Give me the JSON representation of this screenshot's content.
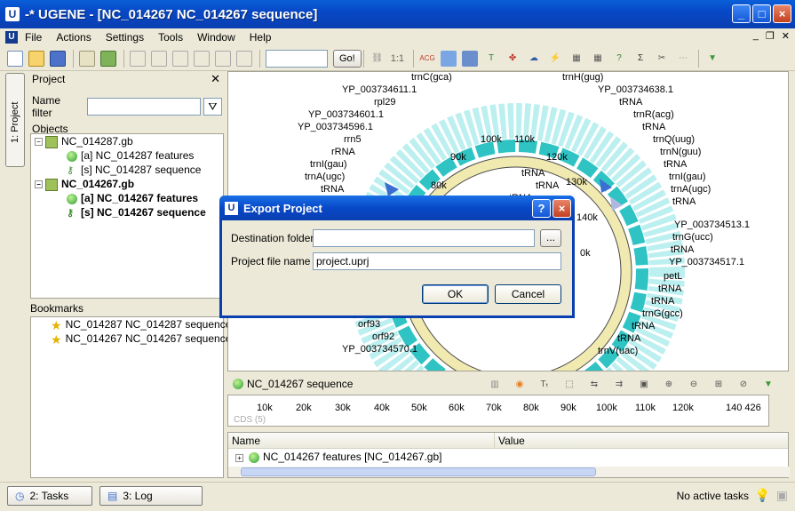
{
  "window": {
    "title": "-* UGENE - [NC_014267 NC_014267 sequence]",
    "app_icon": "U"
  },
  "menu": [
    "File",
    "Actions",
    "Settings",
    "Tools",
    "Window",
    "Help"
  ],
  "toolbar": {
    "go_label": "Go!",
    "zoom_label": "1:1"
  },
  "side_tab": {
    "label": "1: Project"
  },
  "project_panel": {
    "title": "Project",
    "name_filter_label": "Name filter",
    "objects_label": "Objects",
    "tree": [
      {
        "text": "NC_014287.gb",
        "bold": false,
        "level": 0,
        "kind": "gb"
      },
      {
        "text": "[a] NC_014287 features",
        "bold": false,
        "level": 1,
        "kind": "features"
      },
      {
        "text": "[s] NC_014287 sequence",
        "bold": false,
        "level": 1,
        "kind": "sequence"
      },
      {
        "text": "NC_014267.gb",
        "bold": true,
        "level": 0,
        "kind": "gb"
      },
      {
        "text": "[a] NC_014267 features",
        "bold": true,
        "level": 1,
        "kind": "features"
      },
      {
        "text": "[s] NC_014267 sequence",
        "bold": true,
        "level": 1,
        "kind": "sequence"
      }
    ],
    "bookmarks_label": "Bookmarks",
    "bookmarks": [
      "NC_014287 NC_014287 sequence",
      "NC_014267 NC_014267 sequence"
    ]
  },
  "circular_view": {
    "position_labels": [
      "100k",
      "110k",
      "90k",
      "120k",
      "80k",
      "130k",
      "140k",
      "0k"
    ],
    "feature_labels_left": [
      "trnC(gca)",
      "YP_003734611.1",
      "rpl29",
      "YP_003734601.1",
      "YP_003734596.1",
      "rrn5",
      "rRNA",
      "trnI(gau)",
      "trnA(ugc)",
      "tRNA",
      "orf93",
      "orf92",
      "YP_003734570.1"
    ],
    "feature_labels_right": [
      "trnH(gug)",
      "YP_003734638.1",
      "tRNA",
      "trnR(acg)",
      "tRNA",
      "trnQ(uug)",
      "trnN(guu)",
      "tRNA",
      "tRNA",
      "trnI(gau)",
      "trnA(ugc)",
      "tRNA",
      "tRNA",
      "tRNA",
      "YP_003734513.1",
      "trnG(ucc)",
      "tRNA",
      "YP_003734517.1",
      "petL",
      "tRNA",
      "tRNA",
      "trnG(gcc)",
      "tRNA",
      "tRNA",
      "trnV(uac)"
    ]
  },
  "sequence_bar": {
    "name": "NC_014267 sequence",
    "ruler_ticks": [
      "10k",
      "20k",
      "30k",
      "40k",
      "50k",
      "60k",
      "70k",
      "80k",
      "90k",
      "100k",
      "110k",
      "120k",
      "140 426"
    ],
    "track_label": "CDS (5)"
  },
  "annotations": {
    "columns": [
      "Name",
      "Value"
    ],
    "rows": [
      "NC_014267 features [NC_014267.gb]"
    ]
  },
  "status": {
    "tasks_tab": "2: Tasks",
    "log_tab": "3: Log",
    "text": "No active tasks"
  },
  "dialog": {
    "title": "Export Project",
    "destination_label": "Destination folder",
    "destination_value": "",
    "browse_label": "...",
    "filename_label": "Project file name",
    "filename_value": "project.uprj",
    "ok_label": "OK",
    "cancel_label": "Cancel"
  },
  "colors": {
    "accent": "#0a3fb0",
    "map_ring": "#f0eab0",
    "map_features": "#20c8c8"
  }
}
